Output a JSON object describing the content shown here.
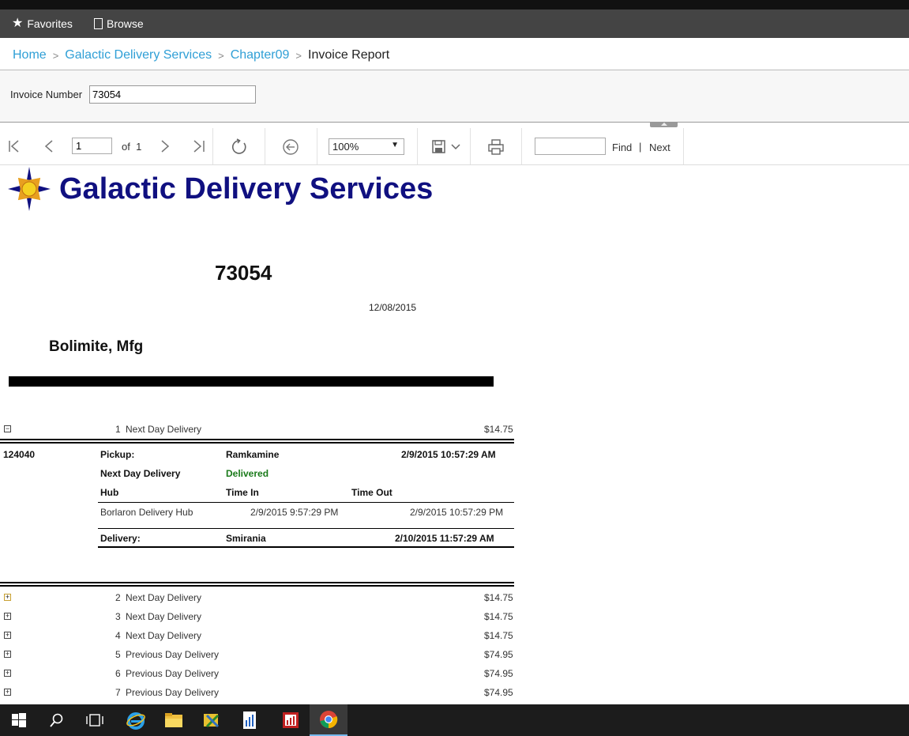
{
  "nav": {
    "favorites": "Favorites",
    "browse": "Browse"
  },
  "breadcrumb": {
    "home": "Home",
    "folder": "Galactic Delivery Services",
    "subfolder": "Chapter09",
    "current": "Invoice Report"
  },
  "params": {
    "invoice_label": "Invoice Number",
    "invoice_value": "73054"
  },
  "toolbar": {
    "page_value": "1",
    "of_label": "of  1",
    "zoom_value": "100%",
    "find_label": "Find",
    "find_sep": "|",
    "next_label": "Next"
  },
  "report": {
    "company": "Galactic Delivery Services",
    "invoice_number": "73054",
    "invoice_date": "12/08/2015",
    "customer": "Bolimite, Mfg",
    "first_line": {
      "num": "1",
      "service": "Next Day Delivery",
      "amount": "$14.75"
    },
    "detail": {
      "package_id": "124040",
      "pickup_label": "Pickup:",
      "pickup_planet": "Ramkamine",
      "pickup_time": "2/9/2015 10:57:29 AM",
      "service": "Next Day Delivery",
      "status": "Delivered",
      "col_hub": "Hub",
      "col_time_in": "Time In",
      "col_time_out": "Time Out",
      "hub_name": "Borlaron Delivery Hub",
      "hub_time_in": "2/9/2015 9:57:29 PM",
      "hub_time_out": "2/9/2015 10:57:29 PM",
      "delivery_label": "Delivery:",
      "delivery_planet": "Smirania",
      "delivery_time": "2/10/2015 11:57:29 AM"
    },
    "lines": [
      {
        "num": "2",
        "service": "Next Day Delivery",
        "amount": "$14.75"
      },
      {
        "num": "3",
        "service": "Next Day Delivery",
        "amount": "$14.75"
      },
      {
        "num": "4",
        "service": "Next Day Delivery",
        "amount": "$14.75"
      },
      {
        "num": "5",
        "service": "Previous Day Delivery",
        "amount": "$74.95"
      },
      {
        "num": "6",
        "service": "Previous Day Delivery",
        "amount": "$74.95"
      },
      {
        "num": "7",
        "service": "Previous Day Delivery",
        "amount": "$74.95"
      }
    ]
  },
  "colors": {
    "brand_blue": "#101080",
    "link_blue": "#2f9fd6",
    "delivered_green": "#1a7a1a",
    "navbar": "#444444"
  }
}
